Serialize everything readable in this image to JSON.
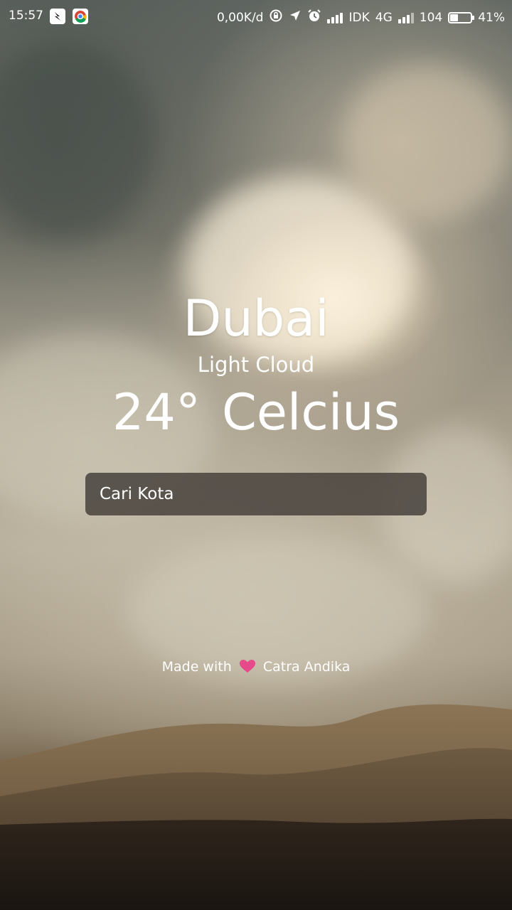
{
  "status_bar": {
    "time": "15:57",
    "app_icons": [
      "notification-app-icon",
      "chrome-icon"
    ],
    "net_speed": "0,00K/d",
    "carrier_1": "IDK",
    "network_type": "4G",
    "carrier_2": "104",
    "battery_percent": "41%",
    "battery_level": 0.41
  },
  "weather": {
    "city": "Dubai",
    "condition": "Light Cloud",
    "temperature": "24°",
    "unit": "Celcius"
  },
  "search": {
    "placeholder": "Cari Kota"
  },
  "footer": {
    "made_with": "Made with",
    "heart_icon": "heart-icon",
    "heart_color": "#e64a8a",
    "author": "Catra Andika"
  }
}
